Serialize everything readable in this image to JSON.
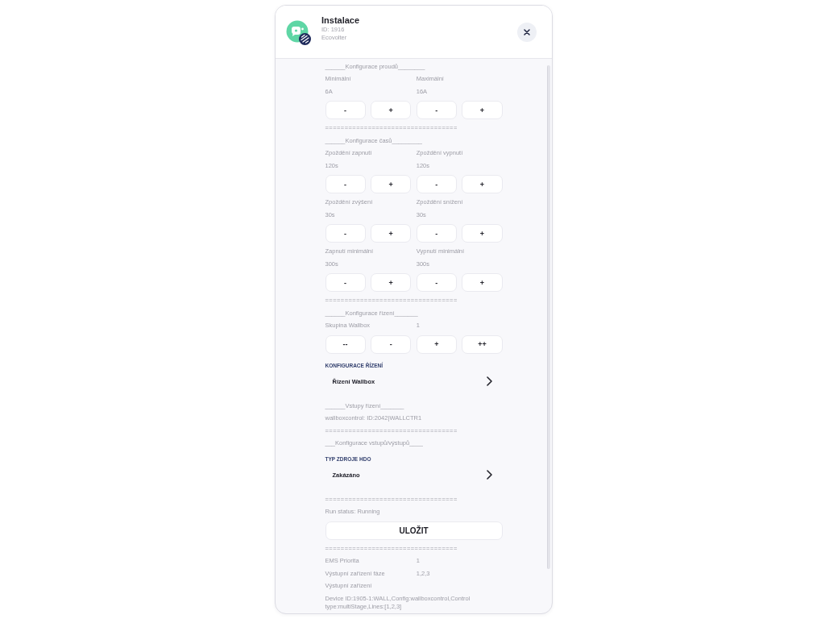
{
  "header": {
    "title": "Instalace",
    "id": "ID: 1916",
    "vendor": "Ecovolter"
  },
  "body": [
    {
      "kind": "heading",
      "text": "______Konfigurace proudů________"
    },
    {
      "kind": "fields",
      "fields": [
        {
          "label": "Minimální",
          "value": "6A"
        },
        {
          "label": "Maximální",
          "value": "16A"
        }
      ]
    },
    {
      "kind": "steppers",
      "buttons": [
        "-",
        "+",
        "-",
        "+"
      ]
    },
    {
      "kind": "divider",
      "text": "=================================="
    },
    {
      "kind": "heading",
      "text": "______Konfigurace časů_________"
    },
    {
      "kind": "fields",
      "fields": [
        {
          "label": "Zpoždění zapnutí",
          "value": "120s"
        },
        {
          "label": "Zpoždění vypnutí",
          "value": "120s"
        }
      ]
    },
    {
      "kind": "steppers",
      "buttons": [
        "-",
        "+",
        "-",
        "+"
      ]
    },
    {
      "kind": "fields",
      "fields": [
        {
          "label": "Zpoždění zvýšení",
          "value": "30s"
        },
        {
          "label": "Zpoždění snížení",
          "value": "30s"
        }
      ]
    },
    {
      "kind": "steppers",
      "buttons": [
        "-",
        "+",
        "-",
        "+"
      ]
    },
    {
      "kind": "fields",
      "fields": [
        {
          "label": "Zapnutí minimální",
          "value": "300s"
        },
        {
          "label": "Vypnutí minimální",
          "value": "300s"
        }
      ]
    },
    {
      "kind": "steppers",
      "buttons": [
        "-",
        "+",
        "-",
        "+"
      ]
    },
    {
      "kind": "divider",
      "text": "=================================="
    },
    {
      "kind": "heading",
      "text": "______Konfigurace řízení_______"
    },
    {
      "kind": "pair",
      "label": "Skupina Wallbox",
      "value": "1"
    },
    {
      "kind": "steppers",
      "buttons": [
        "--",
        "-",
        "+",
        "++"
      ]
    },
    {
      "kind": "group_title",
      "text": "KONFIGURACE ŘÍZENÍ"
    },
    {
      "kind": "menu_row",
      "label": "Řízení Wallbox"
    },
    {
      "kind": "heading",
      "text": "______Vstupy řízení_______"
    },
    {
      "kind": "text",
      "text": "wallboxcontrol: ID:2042|WALLCTR1"
    },
    {
      "kind": "divider",
      "text": "=================================="
    },
    {
      "kind": "heading",
      "text": "___Konfigurace vstupů/výstupů____"
    },
    {
      "kind": "group_title",
      "text": "TYP ZDROJE HDO"
    },
    {
      "kind": "menu_row",
      "label": "Zakázáno"
    },
    {
      "kind": "divider",
      "text": "=================================="
    },
    {
      "kind": "text",
      "text": "Run status: Running"
    },
    {
      "kind": "save_button",
      "label": "ULOŽIT"
    },
    {
      "kind": "divider",
      "text": "=================================="
    },
    {
      "kind": "pair",
      "label": "EMS Priorita",
      "value": "1"
    },
    {
      "kind": "pair",
      "label": "Výstupní zařízení fáze",
      "value": "1,2,3"
    },
    {
      "kind": "text",
      "text": "Výstupní zařízení"
    },
    {
      "kind": "text",
      "text": "Device ID:1905-1:WALL,Config:wallboxcontrol,Control type:multiStage,Lines:[1,2,3]"
    }
  ]
}
